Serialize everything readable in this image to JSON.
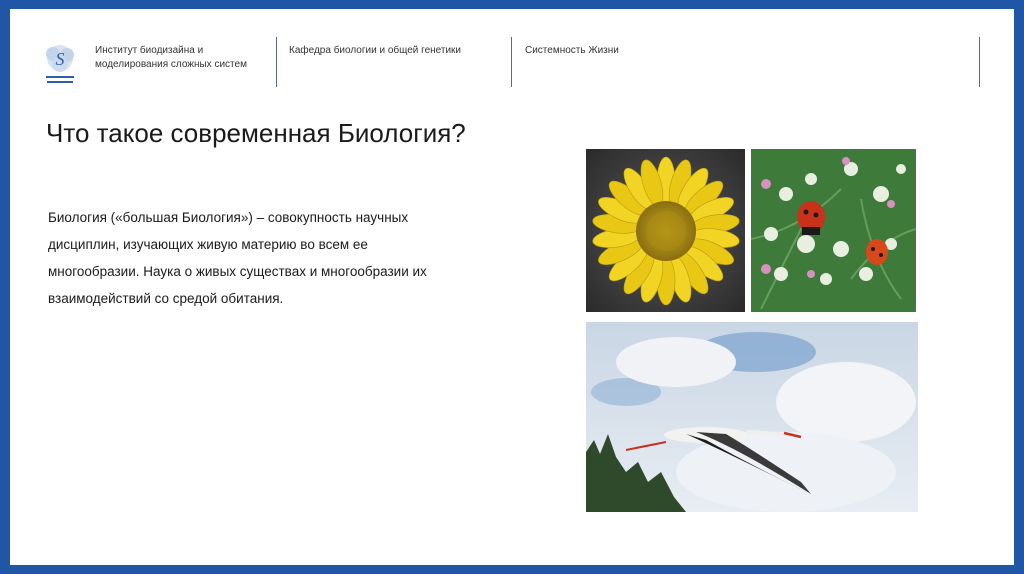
{
  "header": {
    "institute": [
      "Институт биодизайна и",
      "моделирования сложных систем"
    ],
    "department": "Кафедра биологии и общей генетики",
    "topic": "Системность Жизни"
  },
  "slide": {
    "title": "Что такое современная Биология?",
    "body_lines": [
      "Биология («большая Биология») – совокупность научных",
      "дисциплин, изучающих живую материю во всем ее",
      "многообразии. Наука о живых существах и многообразии их",
      "взаимодействий со средой обитания."
    ]
  },
  "colors": {
    "frame": "#1f57a6",
    "logo_blue": "#2f5ea8",
    "sunflower_yellow": "#e8c814",
    "ladybug_red": "#c8321a",
    "sky_blue": "#7aa3cf"
  },
  "images": [
    {
      "subject": "yellow-flower",
      "icon": "flower-photo"
    },
    {
      "subject": "ladybugs-on-flowers",
      "icon": "ladybug-photo"
    },
    {
      "subject": "stork-in-flight",
      "icon": "stork-photo"
    }
  ]
}
